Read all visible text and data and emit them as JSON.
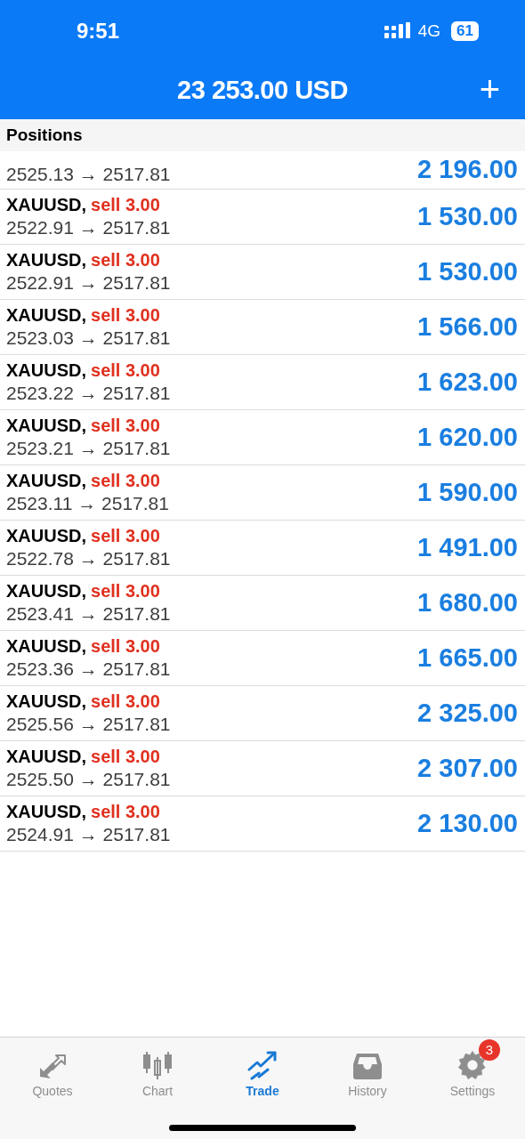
{
  "status_bar": {
    "time": "9:51",
    "network": "4G",
    "battery": "61"
  },
  "header": {
    "title": "23 253.00 USD",
    "add_label": "+"
  },
  "section": {
    "title": "Positions"
  },
  "positions": [
    {
      "prices": "2525.13 → 2517.81",
      "profit": "2 196.00"
    },
    {
      "symbol": "XAUUSD,",
      "order": "sell 3.00",
      "prices": "2522.91 → 2517.81",
      "profit": "1 530.00"
    },
    {
      "symbol": "XAUUSD,",
      "order": "sell 3.00",
      "prices": "2522.91 → 2517.81",
      "profit": "1 530.00"
    },
    {
      "symbol": "XAUUSD,",
      "order": "sell 3.00",
      "prices": "2523.03 → 2517.81",
      "profit": "1 566.00"
    },
    {
      "symbol": "XAUUSD,",
      "order": "sell 3.00",
      "prices": "2523.22 → 2517.81",
      "profit": "1 623.00"
    },
    {
      "symbol": "XAUUSD,",
      "order": "sell 3.00",
      "prices": "2523.21 → 2517.81",
      "profit": "1 620.00"
    },
    {
      "symbol": "XAUUSD,",
      "order": "sell 3.00",
      "prices": "2523.11 → 2517.81",
      "profit": "1 590.00"
    },
    {
      "symbol": "XAUUSD,",
      "order": "sell 3.00",
      "prices": "2522.78 → 2517.81",
      "profit": "1 491.00"
    },
    {
      "symbol": "XAUUSD,",
      "order": "sell 3.00",
      "prices": "2523.41 → 2517.81",
      "profit": "1 680.00"
    },
    {
      "symbol": "XAUUSD,",
      "order": "sell 3.00",
      "prices": "2523.36 → 2517.81",
      "profit": "1 665.00"
    },
    {
      "symbol": "XAUUSD,",
      "order": "sell 3.00",
      "prices": "2525.56 → 2517.81",
      "profit": "2 325.00"
    },
    {
      "symbol": "XAUUSD,",
      "order": "sell 3.00",
      "prices": "2525.50 → 2517.81",
      "profit": "2 307.00"
    },
    {
      "symbol": "XAUUSD,",
      "order": "sell 3.00",
      "prices": "2524.91 → 2517.81",
      "profit": "2 130.00"
    }
  ],
  "tabs": [
    {
      "kind": "quotes",
      "label": "Quotes",
      "selected": false
    },
    {
      "kind": "chart",
      "label": "Chart",
      "selected": false
    },
    {
      "kind": "trade",
      "label": "Trade",
      "selected": true
    },
    {
      "kind": "history",
      "label": "History",
      "selected": false
    },
    {
      "kind": "settings",
      "label": "Settings",
      "selected": false,
      "badge": "3"
    }
  ]
}
